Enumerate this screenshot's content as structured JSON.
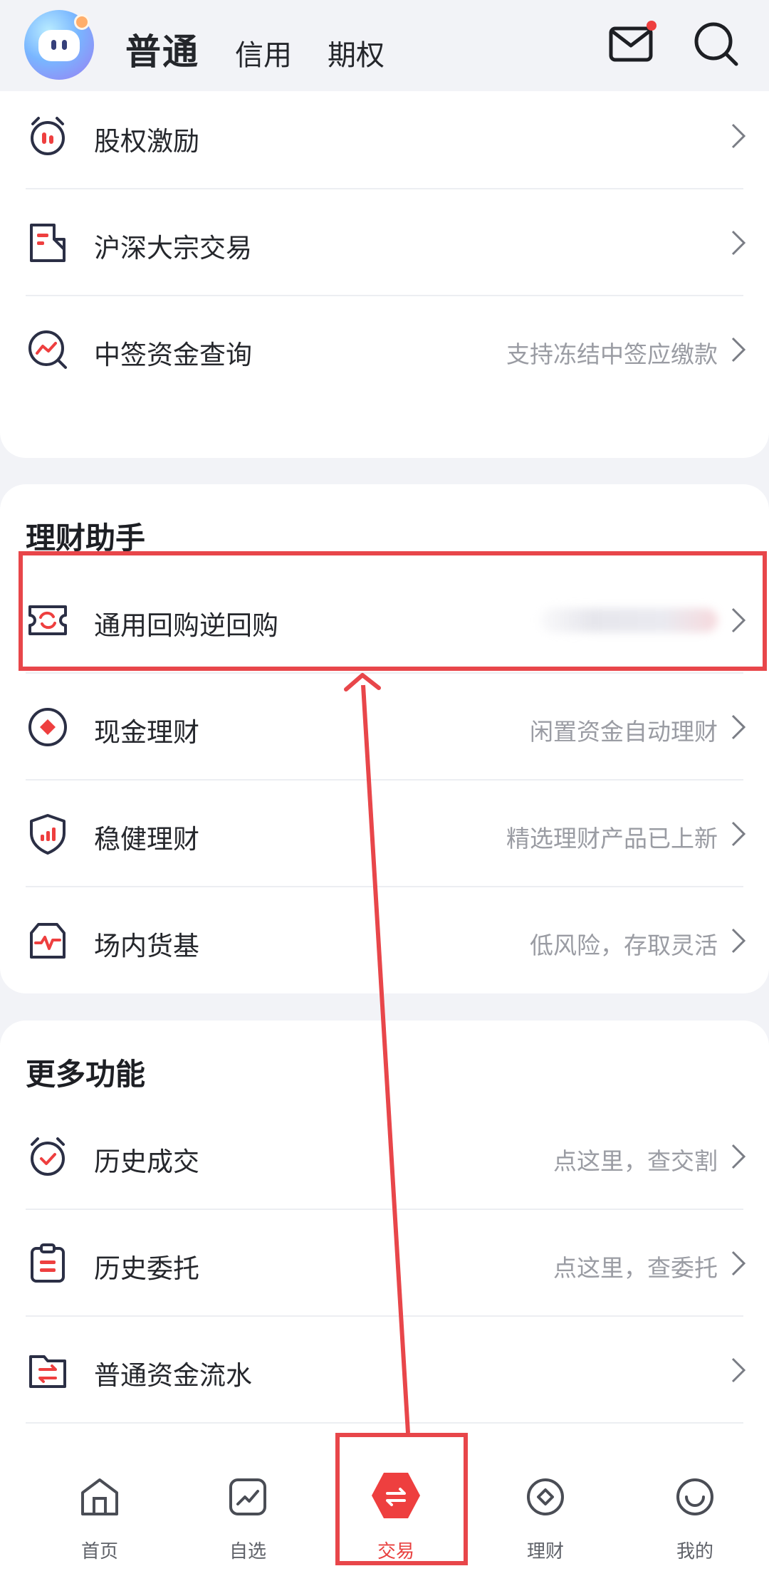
{
  "header": {
    "tabs": [
      {
        "label": "普通",
        "active": true
      },
      {
        "label": "信用",
        "active": false
      },
      {
        "label": "期权",
        "active": false
      }
    ],
    "mail_icon": "mail-icon",
    "mail_has_unread": true,
    "search_icon": "search-icon"
  },
  "section_top": {
    "items": [
      {
        "label": "",
        "hint": "",
        "icon": "partially-hidden-icon"
      },
      {
        "label": "股权激励",
        "hint": "",
        "icon": "alarm-clock-icon"
      },
      {
        "label": "沪深大宗交易",
        "hint": "",
        "icon": "document-icon"
      },
      {
        "label": "中签资金查询",
        "hint": "支持冻结中签应缴款",
        "icon": "chart-search-icon"
      }
    ]
  },
  "section_finance": {
    "title": "理财助手",
    "items": [
      {
        "label": "通用回购逆回购",
        "hint": "",
        "hint_blurred": true,
        "icon": "repo-ticket-icon",
        "highlighted": true
      },
      {
        "label": "现金理财",
        "hint": "闲置资金自动理财",
        "icon": "coin-icon"
      },
      {
        "label": "稳健理财",
        "hint": "精选理财产品已上新",
        "icon": "shield-chart-icon"
      },
      {
        "label": "场内货基",
        "hint": "低风险，存取灵活",
        "icon": "pulse-wallet-icon"
      }
    ]
  },
  "section_more": {
    "title": "更多功能",
    "items": [
      {
        "label": "历史成交",
        "hint": "点这里，查交割",
        "icon": "clock-check-icon"
      },
      {
        "label": "历史委托",
        "hint": "点这里，查委托",
        "icon": "clipboard-icon"
      },
      {
        "label": "普通资金流水",
        "hint": "",
        "icon": "folder-transfer-icon"
      }
    ]
  },
  "bottom_nav": {
    "items": [
      {
        "label": "首页",
        "icon": "home-icon",
        "active": false
      },
      {
        "label": "自选",
        "icon": "trend-icon",
        "active": false
      },
      {
        "label": "交易",
        "icon": "exchange-icon",
        "active": true
      },
      {
        "label": "理财",
        "icon": "wealth-icon",
        "active": false
      },
      {
        "label": "我的",
        "icon": "smile-icon",
        "active": false
      }
    ]
  },
  "colors": {
    "accent": "#e8403f",
    "annotation": "#e8464a",
    "icon_dark": "#2b2f45",
    "hint_text": "#9a9ca3"
  }
}
